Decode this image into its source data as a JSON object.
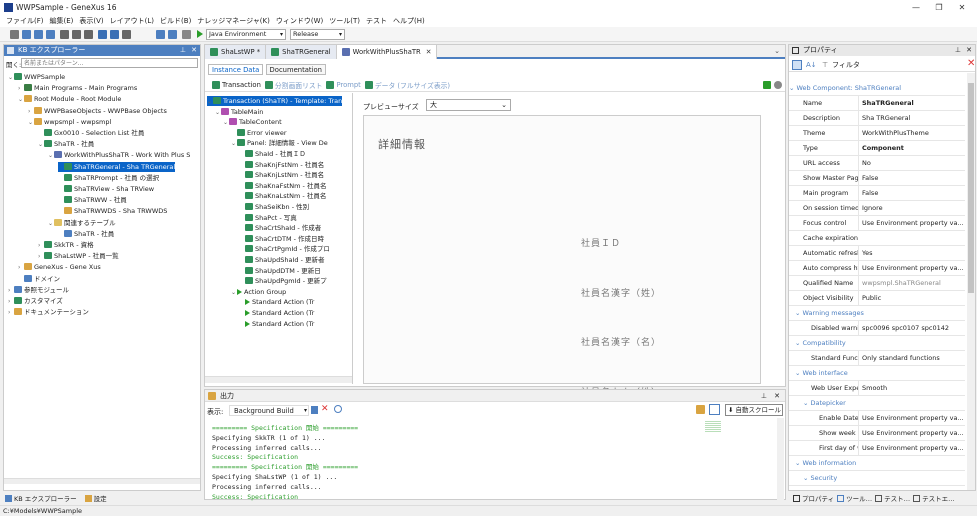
{
  "window": {
    "title": "WWPSample - GeneXus 16",
    "minimize": "—",
    "restore": "❐",
    "close": "✕"
  },
  "menu": [
    "ファイル(F)",
    "編集(E)",
    "表示(V)",
    "レイアウト(L)",
    "ビルド(B)",
    "ナレッジマネージャ(K)",
    "ウィンドウ(W)",
    "ツール(T)",
    "テスト",
    "ヘルプ(H)"
  ],
  "toolbar": {
    "environment": "Java Environment",
    "config": "Release"
  },
  "kb": {
    "title": "KB エクスプローラー",
    "search_label": "開く:",
    "search_placeholder": "名前またはパターン...",
    "tree": [
      {
        "label": "WWPSample",
        "indent": 0,
        "exp": "⌄",
        "color": "#2f8f5a"
      },
      {
        "label": "Main Programs - Main Programs",
        "indent": 1,
        "exp": "›",
        "color": "#3a7d44"
      },
      {
        "label": "Root Module - Root Module",
        "indent": 1,
        "exp": "⌄",
        "color": "#d9a441"
      },
      {
        "label": "WWPBaseObjects - WWPBase Objects",
        "indent": 2,
        "exp": "›",
        "color": "#d9a441"
      },
      {
        "label": "wwpsmpl - wwpsmpl",
        "indent": 2,
        "exp": "⌄",
        "color": "#d9a441"
      },
      {
        "label": "Gx0010 - Selection List 社員",
        "indent": 3,
        "exp": "",
        "color": "#2f8f5a"
      },
      {
        "label": "ShaTR - 社員",
        "indent": 3,
        "exp": "⌄",
        "color": "#2f8f5a"
      },
      {
        "label": "WorkWithPlusShaTR - Work With Plus S",
        "indent": 4,
        "exp": "⌄",
        "color": "#5a6fb0"
      },
      {
        "label": "ShaTRGeneral - Sha TRGeneral",
        "indent": 5,
        "exp": "",
        "color": "#2f8f5a",
        "selected": true
      },
      {
        "label": "ShaTRPrompt - 社員 の選択",
        "indent": 5,
        "exp": "",
        "color": "#2f8f5a"
      },
      {
        "label": "ShaTRView - Sha TRView",
        "indent": 5,
        "exp": "",
        "color": "#2f8f5a"
      },
      {
        "label": "ShaTRWW - 社員",
        "indent": 5,
        "exp": "",
        "color": "#2f8f5a"
      },
      {
        "label": "ShaTRWWDS - Sha TRWWDS",
        "indent": 5,
        "exp": "",
        "color": "#d9a441"
      },
      {
        "label": "関連するテーブル",
        "indent": 4,
        "exp": "⌄",
        "color": "#e0c060"
      },
      {
        "label": "ShaTR - 社員",
        "indent": 5,
        "exp": "",
        "color": "#4d7fc0"
      },
      {
        "label": "SkkTR - 資格",
        "indent": 3,
        "exp": "›",
        "color": "#2f8f5a"
      },
      {
        "label": "ShaLstWP - 社員一覧",
        "indent": 3,
        "exp": "›",
        "color": "#2f8f5a"
      },
      {
        "label": "GeneXus - Gene Xus",
        "indent": 1,
        "exp": "›",
        "color": "#d9a441"
      },
      {
        "label": "ドメイン",
        "indent": 1,
        "exp": "",
        "color": "#4d7fc0"
      },
      {
        "label": "参照モジュール",
        "indent": 0,
        "exp": "›",
        "color": "#4d7fc0"
      },
      {
        "label": "カスタマイズ",
        "indent": 0,
        "exp": "›",
        "color": "#2f8f5a"
      },
      {
        "label": "ドキュメンテーション",
        "indent": 0,
        "exp": "›",
        "color": "#d9a441"
      }
    ],
    "bottom_tabs": [
      "KB エクスプローラー",
      "設定"
    ]
  },
  "editor": {
    "tabs": [
      {
        "label": "ShaLstWP *",
        "active": false
      },
      {
        "label": "ShaTRGeneral",
        "active": false
      },
      {
        "label": "WorkWithPlusShaTR",
        "active": true
      }
    ],
    "sub_tabs": [
      "Instance Data",
      "Documentation"
    ],
    "toolbar": [
      "Transaction",
      "分割画面リスト",
      "Prompt",
      "データ (フルサイズ表示)"
    ],
    "tree": [
      {
        "label": "Transaction (ShaTR) - Template: Tran",
        "indent": 0,
        "exp": "⌄",
        "selected": true
      },
      {
        "label": "TableMain",
        "indent": 1,
        "exp": "⌄"
      },
      {
        "label": "TableContent",
        "indent": 2,
        "exp": "⌄"
      },
      {
        "label": "Error viewer",
        "indent": 3,
        "exp": ""
      },
      {
        "label": "Panel: 詳細情報 - View De",
        "indent": 3,
        "exp": "⌄"
      },
      {
        "label": "ShaId - 社員ＩＤ",
        "indent": 4,
        "exp": ""
      },
      {
        "label": "ShaKnjFstNm - 社員名",
        "indent": 4,
        "exp": ""
      },
      {
        "label": "ShaKnjLstNm - 社員名",
        "indent": 4,
        "exp": ""
      },
      {
        "label": "ShaKnaFstNm - 社員名",
        "indent": 4,
        "exp": ""
      },
      {
        "label": "ShaKnaLstNm - 社員名",
        "indent": 4,
        "exp": ""
      },
      {
        "label": "ShaSeiKbn - 性別",
        "indent": 4,
        "exp": ""
      },
      {
        "label": "ShaPct - 写真",
        "indent": 4,
        "exp": ""
      },
      {
        "label": "ShaCrtShaId - 作成者",
        "indent": 4,
        "exp": ""
      },
      {
        "label": "ShaCrtDTM - 作成日時",
        "indent": 4,
        "exp": ""
      },
      {
        "label": "ShaCrtPgmId - 作成プロ",
        "indent": 4,
        "exp": ""
      },
      {
        "label": "ShaUpdShaId - 更新者",
        "indent": 4,
        "exp": ""
      },
      {
        "label": "ShaUpdDTM - 更新日",
        "indent": 4,
        "exp": ""
      },
      {
        "label": "ShaUpdPgmId - 更新プ",
        "indent": 4,
        "exp": ""
      },
      {
        "label": "Action Group",
        "indent": 3,
        "exp": "⌄"
      },
      {
        "label": "Standard Action (Tr",
        "indent": 4,
        "exp": ""
      },
      {
        "label": "Standard Action (Tr",
        "indent": 4,
        "exp": ""
      },
      {
        "label": "Standard Action (Tr",
        "indent": 4,
        "exp": ""
      }
    ],
    "preview_label": "プレビューサイズ",
    "preview_size": "大",
    "preview_heading": "詳細情報",
    "preview_fields": [
      "社員ＩＤ",
      "社員名漢字（姓）",
      "社員名漢字（名）",
      "社員名カナ（姓）"
    ]
  },
  "output": {
    "title": "出力",
    "show_label": "表示:",
    "source": "Background Build",
    "autoscroll": "自動スクロール",
    "lines": [
      {
        "text": "========= Specification 開始 =========",
        "color": "#2a9d2a"
      },
      {
        "text": " Specifying SkkTR (1 of 1) ...",
        "color": "#1e1e1e"
      },
      {
        "text": "Processing inferred calls...",
        "color": "#1e1e1e"
      },
      {
        "text": "Success: Specification",
        "color": "#2a9d2a"
      },
      {
        "text": "========= Specification 開始 =========",
        "color": "#2a9d2a"
      },
      {
        "text": " Specifying ShaLstWP (1 of 1) ...",
        "color": "#1e1e1e"
      },
      {
        "text": "Processing inferred calls...",
        "color": "#1e1e1e"
      },
      {
        "text": "Success: Specification",
        "color": "#2a9d2a"
      }
    ]
  },
  "properties": {
    "title": "プロパティ",
    "filter_label": "フィルタ",
    "section": "Web Component: ShaTRGeneral",
    "rows": [
      {
        "type": "row",
        "key": "Name",
        "value": "ShaTRGeneral",
        "bold": true
      },
      {
        "type": "row",
        "key": "Description",
        "value": "Sha TRGeneral"
      },
      {
        "type": "row",
        "key": "Theme",
        "value": "WorkWithPlusTheme"
      },
      {
        "type": "row",
        "key": "Type",
        "value": "Component",
        "bold": true
      },
      {
        "type": "row",
        "key": "URL access",
        "value": "No"
      },
      {
        "type": "row",
        "key": "Show Master Page w",
        "value": "False"
      },
      {
        "type": "row",
        "key": "Main program",
        "value": "False"
      },
      {
        "type": "row",
        "key": "On session timeout",
        "value": "Ignore"
      },
      {
        "type": "row",
        "key": "Focus control",
        "value": "Use Environment property va..."
      },
      {
        "type": "row",
        "key": "Cache expiration lap",
        "value": ""
      },
      {
        "type": "row",
        "key": "Automatic refresh",
        "value": "Yes"
      },
      {
        "type": "row",
        "key": "Auto compress http",
        "value": "Use Environment property va..."
      },
      {
        "type": "row",
        "key": "Qualified Name",
        "value": "wwpsmpl.ShaTRGeneral",
        "grey": true
      },
      {
        "type": "row",
        "key": "Object Visibility",
        "value": "Public"
      },
      {
        "type": "cat",
        "key": "Warning messages",
        "indent": 0
      },
      {
        "type": "row",
        "key": "Disabled warnings",
        "value": "spc0096 spc0107 spc0142",
        "indent": 1
      },
      {
        "type": "cat",
        "key": "Compatibility",
        "indent": 0
      },
      {
        "type": "row",
        "key": "Standard Function",
        "value": "Only standard functions",
        "indent": 1
      },
      {
        "type": "cat",
        "key": "Web interface",
        "indent": 0
      },
      {
        "type": "row",
        "key": "Web User Experien",
        "value": "Smooth",
        "indent": 1
      },
      {
        "type": "cat",
        "key": "Datepicker",
        "indent": 1
      },
      {
        "type": "row",
        "key": "Enable Datepicl",
        "value": "Use Environment property va...",
        "indent": 2
      },
      {
        "type": "row",
        "key": "Show week nur",
        "value": "Use Environment property va...",
        "indent": 2
      },
      {
        "type": "row",
        "key": "First day of wee",
        "value": "Use Environment property va...",
        "indent": 2
      },
      {
        "type": "cat",
        "key": "Web information",
        "indent": 0
      },
      {
        "type": "cat",
        "key": "Security",
        "indent": 1
      }
    ],
    "bottom_tabs": [
      "プロパティ",
      "ツール…",
      "テスト…",
      "テストエ…"
    ]
  },
  "statusbar": {
    "path": "C:¥Models¥WWPSample"
  }
}
